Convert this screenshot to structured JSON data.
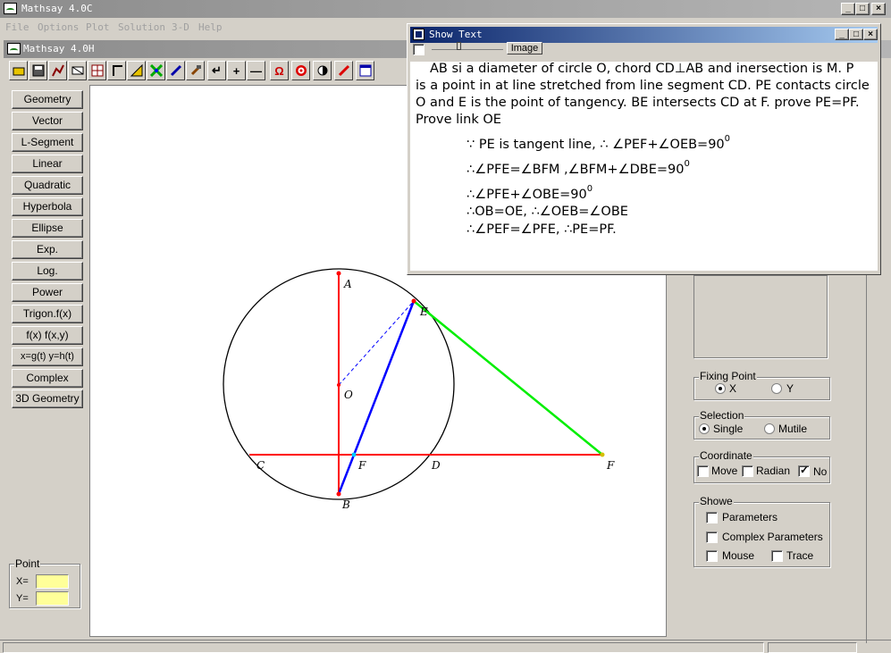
{
  "outer_window": {
    "title": "Mathsay 4.0C"
  },
  "menu": [
    "File",
    "Options",
    "Plot",
    "Solution",
    "3-D",
    "Help"
  ],
  "inner_window": {
    "title": "Mathsay 4.0H"
  },
  "toolbar_icons": [
    "open-icon",
    "save-icon",
    "plot-icon",
    "erase-icon",
    "grid-icon",
    "angle-icon",
    "measure-icon",
    "intersect-icon",
    "pen-icon",
    "hammer-icon",
    "return-icon",
    "plus-icon",
    "minus-icon",
    "omega-icon",
    "target-icon",
    "contrast-icon",
    "pencil-icon",
    "window-icon"
  ],
  "function_buttons": [
    "Geometry",
    "Vector",
    "L-Segment",
    "Linear",
    "Quadratic",
    "Hyperbola",
    "Ellipse",
    "Exp.",
    "Log.",
    "Power",
    "Trigon.f(x)",
    "f(x)  f(x,y)",
    "x=g(t) y=h(t)",
    "Complex",
    "3D Geometry"
  ],
  "point_box": {
    "label": "Point",
    "x_label": "X=",
    "y_label": "Y="
  },
  "geometry_labels": {
    "A": "A",
    "E": "E",
    "O": "O",
    "C": "C",
    "F_inner": "F",
    "D": "D",
    "B": "B",
    "P": "F"
  },
  "fixing_point": {
    "label": "Fixing Point",
    "options": [
      "X",
      "Y"
    ],
    "selected": "X"
  },
  "selection": {
    "label": "Selection",
    "options": [
      "Single",
      "Mutile"
    ],
    "selected": "Single"
  },
  "coordinate": {
    "label": "Coordinate",
    "options": [
      "Move",
      "Radian",
      "No"
    ],
    "checked": "No"
  },
  "showe": {
    "label": "Showe",
    "options": [
      "Parameters",
      "Complex Parameters",
      "Mouse",
      "Trace"
    ]
  },
  "show_text": {
    "title": "Show Text",
    "image_button": "Image",
    "problem": [
      "AB si a diameter of circle O, chord CD⊥AB and inersection is M. P",
      "is a point in at line stretched from line segment CD. PE contacts circle",
      "O and E is the point of tangency. BE intersects CD at F. prove PE=PF.",
      "Prove link OE"
    ],
    "steps": [
      {
        "text": "∵ PE is tangent line, ∴ ∠PEF+∠OEB=90",
        "sup": "0"
      },
      {
        "text": "∴∠PFE=∠BFM ,∠BFM+∠DBE=90",
        "sup": "0"
      },
      {
        "text": "∴∠PFE+∠OBE=90",
        "sup": "0"
      },
      {
        "text": "∴OB=OE, ∴∠OEB=∠OBE",
        "sup": ""
      },
      {
        "text": "∴∠PEF=∠PFE, ∴PE=PF.",
        "sup": ""
      }
    ]
  },
  "colors": {
    "red": "#ff0000",
    "blue": "#0000ff",
    "green": "#00ee00",
    "title_active": "#0a246a",
    "title_inactive": "#8c8c8c",
    "yellow_field": "#ffff99"
  }
}
